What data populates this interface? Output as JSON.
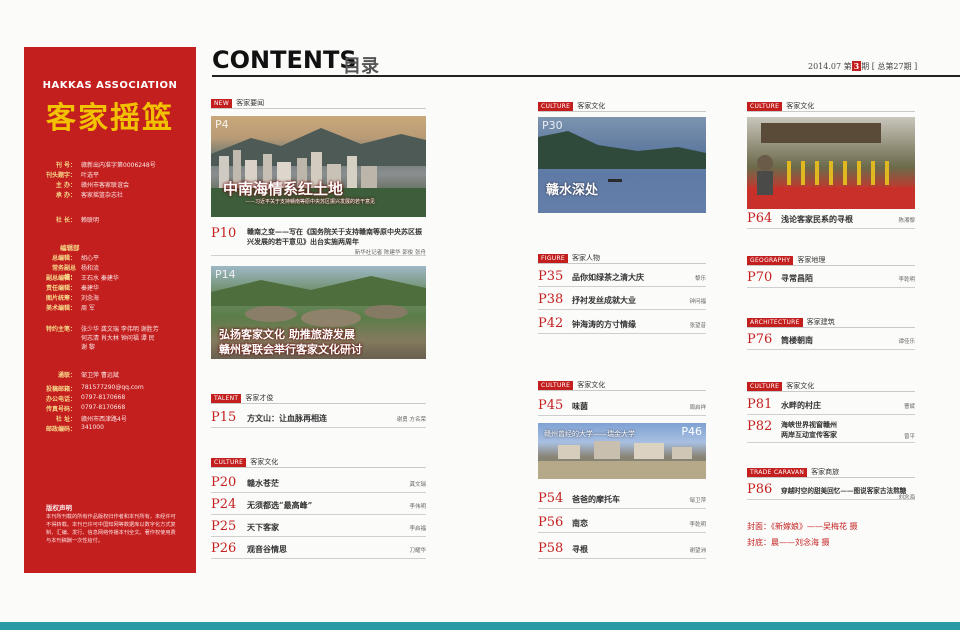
{
  "header": {
    "contents": "CONTENTS",
    "mulu": "目录",
    "issue_pre": "2014.07 第",
    "issue_num": "3",
    "issue_post": "期 [ 总第27期 ]"
  },
  "sidebar": {
    "assoc": "HAKKAS ASSOCIATION",
    "title": "客家摇篮",
    "info": [
      {
        "k": "刊 号：",
        "v": "赣新出内准字第0006248号"
      },
      {
        "k": "刊头题字：",
        "v": "叶选平"
      },
      {
        "k": "主 办：",
        "v": "赣州市客家联谊会"
      },
      {
        "k": "承 办：",
        "v": "客家摇篮杂志社"
      }
    ],
    "president": {
      "k": "社 长：",
      "v": "赖联明"
    },
    "editorial_head": "编辑部",
    "editorial": [
      {
        "k": "总编辑：",
        "v": "胡心平"
      },
      {
        "k": "常务副总编：",
        "v": "杨和流"
      },
      {
        "k": "副总编辑：",
        "v": "王石水  秦建华"
      },
      {
        "k": "责任编辑：",
        "v": "秦建华"
      },
      {
        "k": "图片统筹：",
        "v": "刘念海"
      },
      {
        "k": "美术编辑：",
        "v": "周 军"
      }
    ],
    "special": {
      "k": "特约主笔：",
      "v": [
        "张少华  龚文瑞  李伟明  谢胜芳",
        "何志清  肖大林  钟问福  谭 民",
        "谢 黎"
      ]
    },
    "contact": [
      {
        "k": "通联：",
        "v": "邹卫萍  曹远斌"
      },
      {
        "k": "投稿邮箱：",
        "v": "781577290@qq.com"
      },
      {
        "k": "办公电话：",
        "v": "0797-8170668"
      },
      {
        "k": "传真号码：",
        "v": "0797-8170668"
      },
      {
        "k": "社 址：",
        "v": "赣州市西津路4号"
      },
      {
        "k": "邮政编码：",
        "v": "341000"
      }
    ],
    "notice_title": "版权声明",
    "notice": "本刊所刊载的所有作品版权归作者和本刊所有，未经许可不得转载。本刊已许可中国知网等数据库以数字化方式复制、汇编、发行、信息网络传播本刊全文。著作权使用费与本刊稿酬一次性给付。"
  },
  "col1": {
    "sec_news": {
      "tag": "NEW",
      "label": "客家要闻"
    },
    "img1": {
      "page": "P4",
      "caption": "中南海情系红土地",
      "sub": "——习近平关于支持赣南等原中央苏区振兴发展的若干意见"
    },
    "entry_p10": {
      "p": "P10",
      "title1": "赣南之变——写在《国务院关于支持赣南等原中央苏区振",
      "title2": "兴发展的若干意见》出台实施两周年",
      "author": "新华社记者 陈建华 郭俊 张舟"
    },
    "img2": {
      "page": "P14",
      "caption1": "弘扬客家文化  助推旅游发展",
      "caption2": "赣州客联会举行客家文化研讨"
    },
    "sec_talent": {
      "tag": "TALENT",
      "label": "客家才俊"
    },
    "entry_p15": {
      "p": "P15",
      "title": "方文山：让血脉再相连",
      "author": "谢勇 方名荣"
    },
    "sec_culture": {
      "tag": "CULTURE",
      "label": "客家文化"
    },
    "entries": [
      {
        "p": "P20",
        "title": "赣水苍茫",
        "author": "龚文瑞"
      },
      {
        "p": "P24",
        "title": "无须都选“最高峰”",
        "author": "李伟明"
      },
      {
        "p": "P25",
        "title": "天下客家",
        "author": "李启福"
      },
      {
        "p": "P26",
        "title": "观音谷情思",
        "author": "刀耀华"
      }
    ]
  },
  "col2": {
    "sec_culture": {
      "tag": "CULTURE",
      "label": "客家文化"
    },
    "img": {
      "page": "P30",
      "caption": "赣水深处"
    },
    "sec_figure": {
      "tag": "FIGURE",
      "label": "客家人物"
    },
    "entries1": [
      {
        "p": "P35",
        "title": "品你如绿茶之清大庆",
        "author": "黎乐"
      },
      {
        "p": "P38",
        "title": "抒衬发丝成就大业",
        "author": "钟问福"
      },
      {
        "p": "P42",
        "title": "钟海涛的方寸情缘",
        "author": "张望昔"
      }
    ],
    "sec_culture2": {
      "tag": "CULTURE",
      "label": "客家文化"
    },
    "entry_p45": {
      "p": "P45",
      "title": "味菌",
      "author": "周启祥"
    },
    "img2": {
      "page": "P46",
      "caption": "赣州曾经的大学——瑞金大学"
    },
    "entries2": [
      {
        "p": "P54",
        "title": "爸爸的摩托车",
        "author": "邹卫萍"
      },
      {
        "p": "P56",
        "title": "南恋",
        "author": "李乾明"
      },
      {
        "p": "P58",
        "title": "寻根",
        "author": "谢望洲"
      }
    ]
  },
  "col3": {
    "sec_culture": {
      "tag": "CULTURE",
      "label": "客家文化"
    },
    "entry_p64": {
      "p": "P64",
      "title": "浅论客家民系的寻根",
      "author": "陈湘黎"
    },
    "sec_geo": {
      "tag": "GEOGRAPHY",
      "label": "客家地理"
    },
    "entry_p70": {
      "p": "P70",
      "title": "寻常昌陌",
      "author": "李乾明"
    },
    "sec_arch": {
      "tag": "ARCHITECTURE",
      "label": "客家建筑"
    },
    "entry_p76": {
      "p": "P76",
      "title": "筒楼朝南",
      "author": "谭佳乐"
    },
    "sec_culture2": {
      "tag": "CULTURE",
      "label": "客家文化"
    },
    "entry_p81": {
      "p": "P81",
      "title": "水畔的村庄",
      "author": "曹斌"
    },
    "entry_p82": {
      "p": "P82",
      "title1": "海峡·世界",
      "title2": "两岸互动宣传客家",
      "title_a": "海峡世界视窗赣州",
      "author": "曾平"
    },
    "sec_trade": {
      "tag": "TRADE CARAVAN",
      "label": "客家商旅"
    },
    "entry_p86": {
      "p": "P86",
      "title": "穿越时空的甜美回忆——图说客家古法熬糖",
      "author": "刘念海"
    },
    "cover1": "封面：《新嫁娘》——吴梅花 摄",
    "cover2": "封底：晨——刘念海 摄"
  },
  "colors": {
    "red": "#c31f1e",
    "gold": "#f2c200",
    "teal": "#2a9aa5"
  }
}
